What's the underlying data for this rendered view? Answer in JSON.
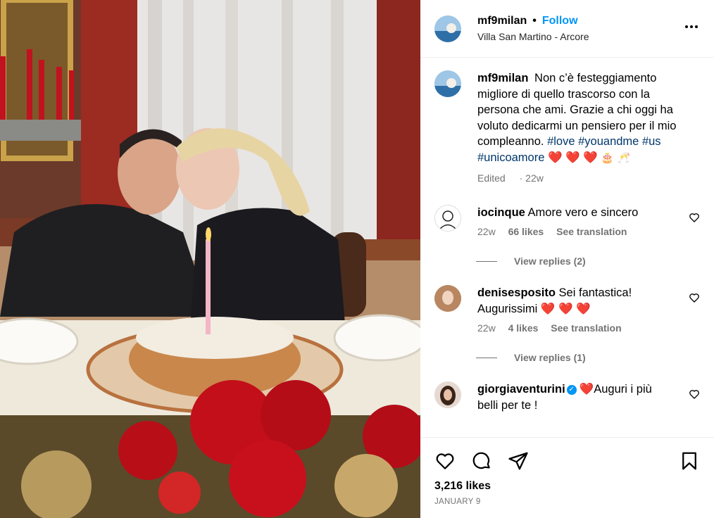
{
  "header": {
    "username": "mf9milan",
    "separator": "•",
    "follow_label": "Follow",
    "location": "Villa San Martino - Arcore",
    "more_icon": "more-horizontal-icon"
  },
  "caption": {
    "username": "mf9milan",
    "text": "Non c’è festeggiamento migliore di quello trascorso con la persona che ami. Grazie a chi oggi ha voluto dedicarmi un pensiero per il mio compleanno.",
    "hashtags": [
      "#love",
      "#youandme",
      "#us",
      "#unicoamore"
    ],
    "emoji_hearts": "❤️ ❤️ ❤️",
    "emoji_cake": "🎂",
    "emoji_cheers": "🥂",
    "edited": "Edited",
    "time": "22w"
  },
  "comments": [
    {
      "username": "iocinque",
      "text": "Amore vero e sincero",
      "time": "22w",
      "likes": "66 likes",
      "translate": "See translation",
      "view_replies": "View replies (2)"
    },
    {
      "username": "denisesposito",
      "text": "Sei fantastica! Augurissimi",
      "emoji": "❤️ ❤️ ❤️",
      "time": "22w",
      "likes": "4 likes",
      "translate": "See translation",
      "view_replies": "View replies (1)"
    },
    {
      "username": "giorgiaventurini",
      "emoji": "❤️",
      "text": "Auguri i più belli per te !"
    }
  ],
  "footer": {
    "likes": "3,216 likes",
    "date": "JANUARY 9"
  },
  "icons": [
    "heart-icon",
    "comment-icon",
    "share-icon",
    "bookmark-icon"
  ],
  "colors": {
    "link": "#0095f6",
    "hashtag": "#00376b",
    "muted": "#737373",
    "heart": "#ed1c24"
  }
}
